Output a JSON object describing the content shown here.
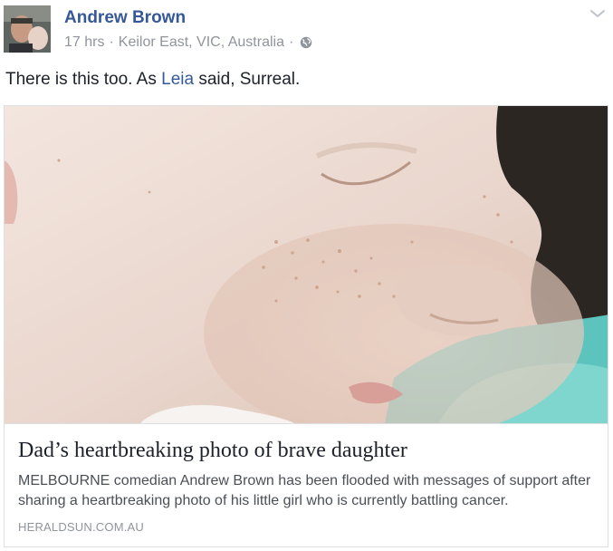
{
  "post": {
    "author": "Andrew Brown",
    "time": "17 hrs",
    "separator": "·",
    "location": "Keilor East, VIC, Australia",
    "privacy_icon": "globe-icon",
    "menu_icon": "chevron-down-icon",
    "text_before": "There is this too. As ",
    "mention": "Leia",
    "text_after": " said, Surreal."
  },
  "link_card": {
    "image_description_icon": "photo",
    "title": "Dad’s heartbreaking photo of brave daughter",
    "description": "MELBOURNE comedian Andrew Brown has been flooded with messages of support after sharing a heartbreaking photo of his little girl who is currently battling cancer.",
    "domain": "HERALDSUN.COM.AU"
  },
  "colors": {
    "author_link": "#365899",
    "meta_gray": "#90949c",
    "text": "#1d2129",
    "border": "#dddfe2"
  }
}
